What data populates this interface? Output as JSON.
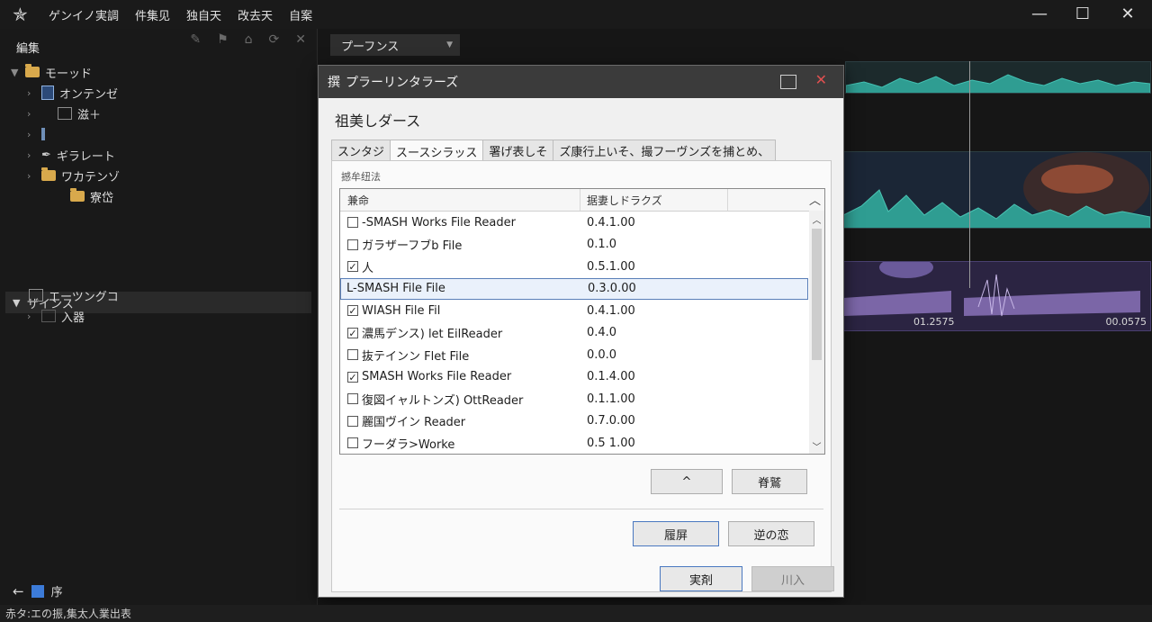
{
  "menubar": {
    "items": [
      "ゲンイノ実調",
      "件集见",
      "独自天",
      "改去天",
      "自案"
    ]
  },
  "sidebar": {
    "panel_title": "編集",
    "tree": [
      {
        "label": "モーッド",
        "level": 0,
        "icon": "folder-icon"
      },
      {
        "label": "オンテンゼ",
        "level": 1,
        "icon": "document-icon"
      },
      {
        "label": "滋＋",
        "level": 2,
        "icon": "film-icon"
      },
      {
        "label": "",
        "level": 1,
        "icon": "bar-icon"
      },
      {
        "label": "ギラレート",
        "level": 1,
        "icon": "pen-icon"
      },
      {
        "label": "ワカテンゾ",
        "level": 1,
        "icon": "folder-icon"
      },
      {
        "label": "寮岱",
        "level": 2,
        "icon": "folder-icon"
      }
    ],
    "section_title": "ザインス",
    "section_items": [
      {
        "label": "エーツングコ",
        "icon": "frame-icon"
      },
      {
        "label": "入器",
        "icon": "list-icon"
      }
    ],
    "bottom_label": "序"
  },
  "statusbar": {
    "text": "赤タ:エの振,集太人業出表"
  },
  "timeline": {
    "preset_label": "プーフンス",
    "clip_times": [
      "01.2575",
      "00.0575"
    ]
  },
  "dialog": {
    "title": "プラーリンタラーズ",
    "title_prefix": "撰",
    "heading": "祖美しダース",
    "tabs": [
      "スンタジ",
      "スースシラッス",
      "署げ表しそ",
      "ズ康行上いそ、撮フーヴンズを捕とめ、"
    ],
    "group_label": "撼牟纽法",
    "columns": [
      "兼命",
      "据妻しドラクズ"
    ],
    "rows": [
      {
        "name": "-SMASH Works File Reader",
        "version": "0.4.1.00",
        "checked": false,
        "selected": false
      },
      {
        "name": "ガラザーフブb File",
        "version": "0.1.0",
        "checked": false,
        "selected": false
      },
      {
        "name": "人",
        "version": "0.5.1.00",
        "checked": true,
        "selected": false
      },
      {
        "name": "L-SMASH File File",
        "version": "0.3.0.00",
        "checked": false,
        "selected": true
      },
      {
        "name": "WIASH File Fil",
        "version": "0.4.1.00",
        "checked": true,
        "selected": false
      },
      {
        "name": "濃馬デンス) let EilReader",
        "version": "0.4.0",
        "checked": true,
        "selected": false
      },
      {
        "name": "抜テインン Flet File",
        "version": "0.0.0",
        "checked": false,
        "selected": false
      },
      {
        "name": "SMASH Works File Reader",
        "version": "0.1.4.00",
        "checked": true,
        "selected": false
      },
      {
        "name": "復図イャルトンズ) OttReader",
        "version": "0.1.1.00",
        "checked": false,
        "selected": false
      },
      {
        "name": "麗国ヴイン Reader",
        "version": "0.7.0.00",
        "checked": false,
        "selected": false
      },
      {
        "name": "フーダラ>Worke",
        "version": "0.5 1.00",
        "checked": false,
        "selected": false
      }
    ],
    "up_button": "^",
    "edit_button": "脊鷲",
    "apply_button": "履屏",
    "reset_button": "逆の恋",
    "ok_button": "実剤",
    "cancel_button": "川入"
  },
  "colors": {
    "waveform": "#34a59a",
    "purple_clip": "#8a72b8",
    "accent": "#3c7bd8"
  }
}
